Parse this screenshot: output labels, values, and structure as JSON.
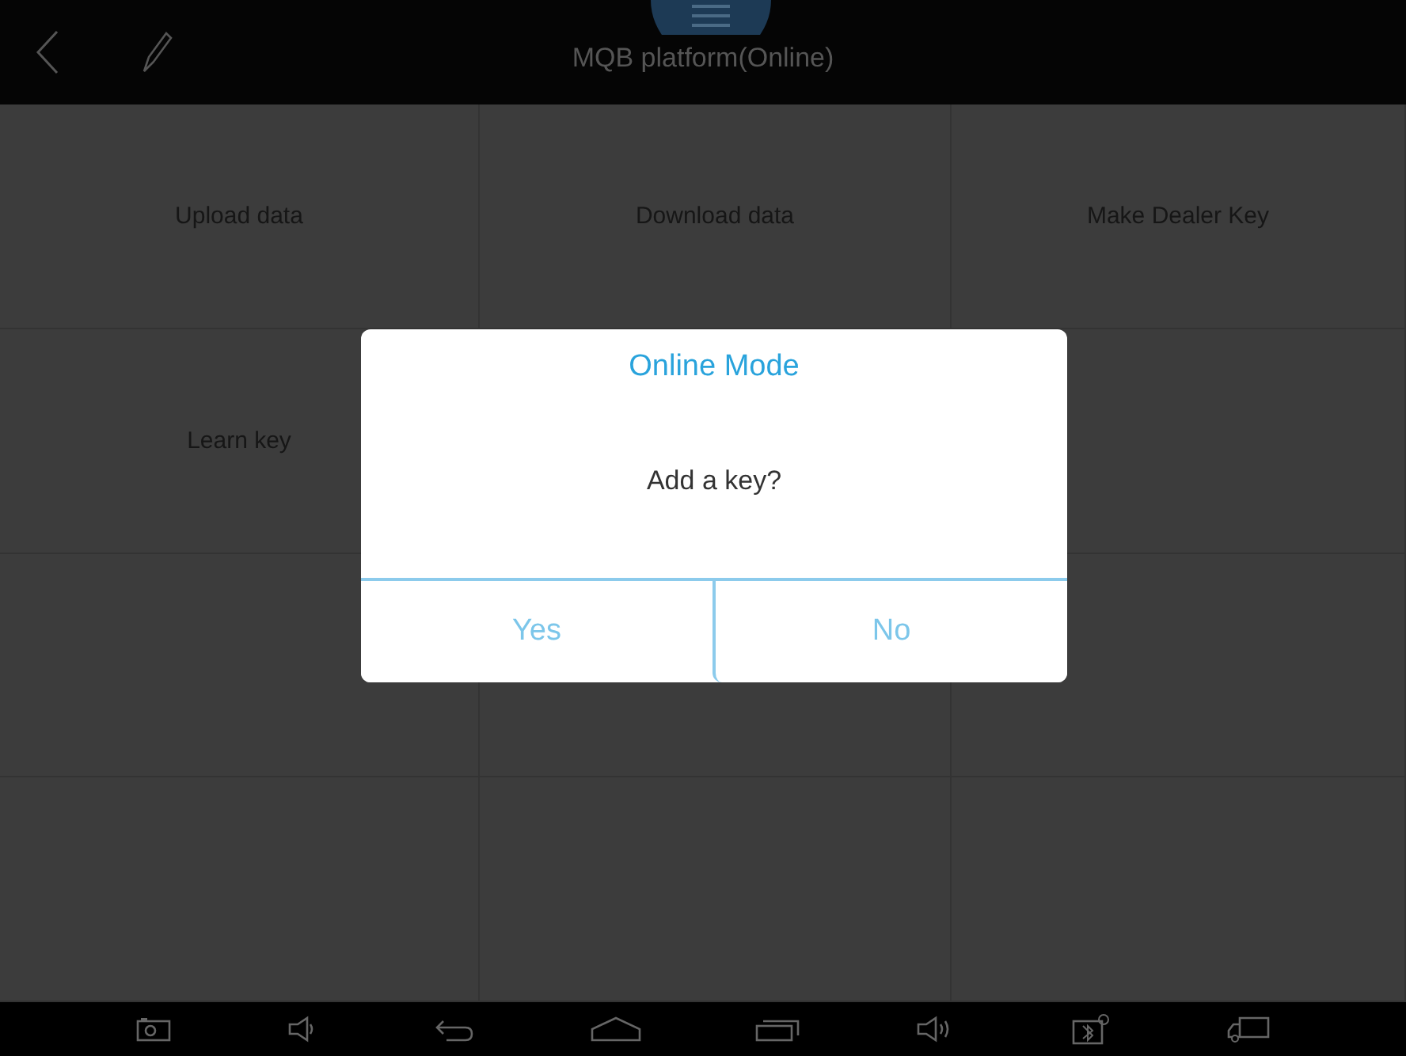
{
  "window": {
    "title": "MQB platform(Online)"
  },
  "tiles": [
    {
      "label": "Upload data"
    },
    {
      "label": "Download data"
    },
    {
      "label": "Make Dealer Key"
    },
    {
      "label": "Learn key"
    }
  ],
  "dialog": {
    "title": "Online Mode",
    "message": "Add a key?",
    "buttons": [
      "Yes",
      "No"
    ]
  }
}
